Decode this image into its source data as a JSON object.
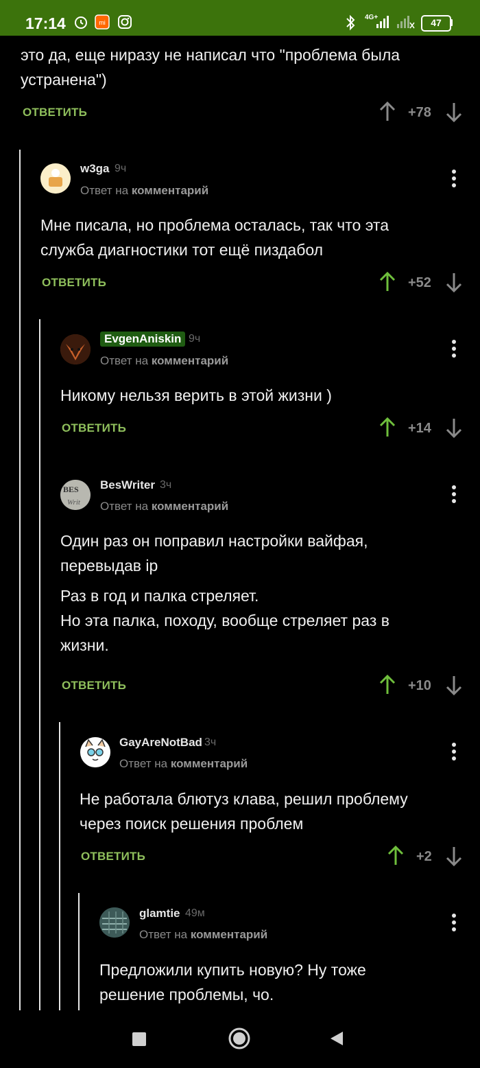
{
  "status_bar": {
    "time": "17:14",
    "network": "4G+",
    "battery": "47"
  },
  "reply_label": "ОТВЕТИТЬ",
  "reply_to_prefix": "Ответ на",
  "reply_to_link": "комментарий",
  "top_comment": {
    "text_lines": [
      "это да, еще ниразу не написал что \"проблема была",
      "устранена\")"
    ],
    "score": "+78"
  },
  "comments": [
    {
      "user": "w3ga",
      "time": "9ч",
      "text_lines": [
        "Мне писала, но проблема осталась, так что эта",
        "служба диагностики тот ещё пиздабол"
      ],
      "score": "+52"
    },
    {
      "user": "EvgenAniskin",
      "time": "9ч",
      "text_lines": [
        "Никому нельзя верить в этой жизни )"
      ],
      "score": "+14"
    },
    {
      "user": "BesWriter",
      "time": "3ч",
      "text_lines": [
        "Один раз он поправил настройки вайфая,",
        "перевыдав ip",
        "Раз в год и палка стреляет.",
        "Но эта палка, походу, вообще стреляет раз в",
        "жизни."
      ],
      "score": "+10"
    },
    {
      "user": "GayAreNotBad",
      "time": "3ч",
      "text_lines": [
        "Не работала блютуз клава, решил проблему",
        "через поиск решения проблем"
      ],
      "score": "+2"
    },
    {
      "user": "glamtie",
      "time": "49м",
      "text_lines": [
        "Предложили купить новую? Ну тоже",
        "решение проблемы, чо."
      ]
    }
  ],
  "colors": {
    "status_bar": "#3c730c",
    "reply": "#8fbf5c",
    "upvoted": "#6fbf3c",
    "background": "#000000"
  }
}
